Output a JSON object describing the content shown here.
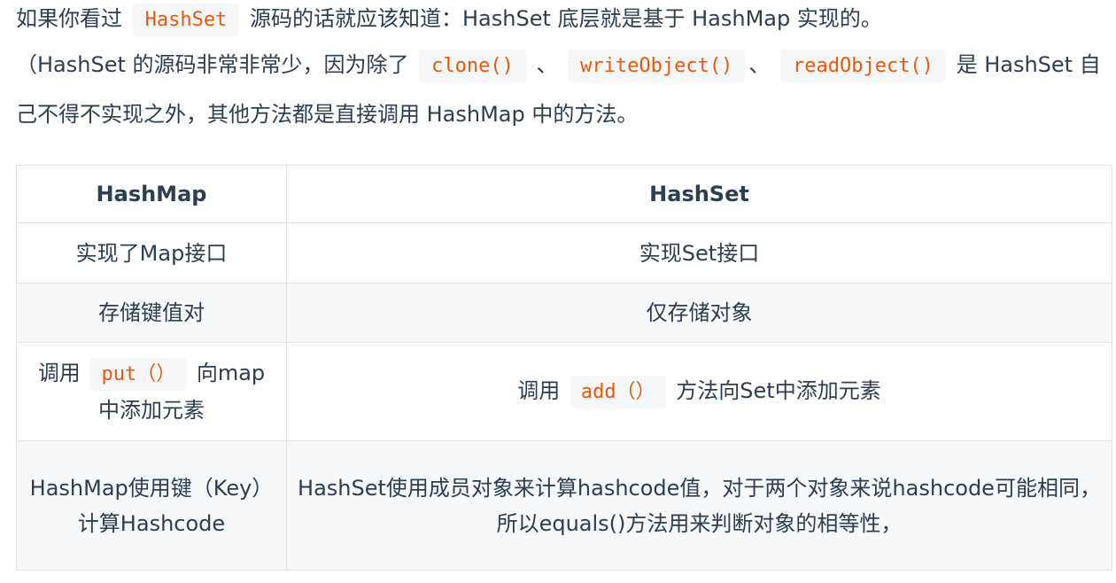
{
  "paragraph1": {
    "before": "如果你看过",
    "code": "HashSet",
    "after": "源码的话就应该知道：HashSet 底层就是基于 HashMap 实现的。"
  },
  "paragraph2": {
    "part1": "（HashSet 的源码非常非常少，因为除了",
    "code1": "clone()",
    "sep1": "、",
    "code2": "writeObject()",
    "sep2": "、",
    "code3": "readObject()",
    "part2": "是 HashSet 自己不得不实现之外，其他方法都是直接调用 HashMap 中的方法。"
  },
  "table": {
    "headers": [
      "HashMap",
      "HashSet"
    ],
    "rows": [
      {
        "left": "实现了Map接口",
        "right": "实现Set接口"
      },
      {
        "left": "存储键值对",
        "right": "仅存储对象"
      },
      {
        "left_before": "调用",
        "left_code": "put（）",
        "left_after": "向map中添加元素",
        "right_before": "调用",
        "right_code": "add（）",
        "right_after": "方法向Set中添加元素"
      },
      {
        "left": "HashMap使用键（Key）计算Hashcode",
        "right": "HashSet使用成员对象来计算hashcode值，对于两个对象来说hashcode可能相同，所以equals()方法用来判断对象的相等性，"
      }
    ]
  }
}
